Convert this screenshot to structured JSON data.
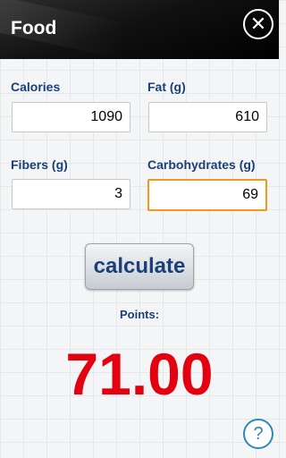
{
  "header": {
    "title": "Food",
    "close_icon": "close-icon"
  },
  "form": {
    "calories": {
      "label": "Calories",
      "value": "1090"
    },
    "fat": {
      "label": "Fat (g)",
      "value": "610"
    },
    "fibers": {
      "label": "Fibers (g)",
      "value": "3"
    },
    "carbohydrates": {
      "label": "Carbohydrates (g)",
      "value": "69"
    }
  },
  "calculate_label": "calculate",
  "points": {
    "label": "Points:",
    "value": "71.00"
  },
  "help": {
    "glyph": "?"
  },
  "colors": {
    "accent": "#1a3f7a",
    "result": "#e3000f",
    "focus": "#f39a1e",
    "help": "#2c8ab8"
  }
}
